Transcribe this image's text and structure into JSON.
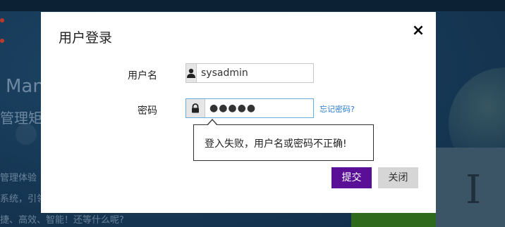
{
  "background": {
    "text_1": "Man",
    "text_2": "管理矩",
    "text_3": "管理体验",
    "text_4": "系统，引领",
    "text_5": "捷、高效、智能！还等什么呢?",
    "right_glyph": "I"
  },
  "dialog": {
    "title": "用户登录",
    "close_icon": "×",
    "username": {
      "label": "用户名",
      "value": "sysadmin",
      "icon": "user-icon"
    },
    "password": {
      "label": "密码",
      "masked_value": "●●●●●",
      "icon": "lock-icon",
      "focused": true
    },
    "forgot_link": "忘记密码?",
    "error_tooltip": "登入失败，用户名或密码不正确!",
    "submit_label": "提交",
    "close_label": "关闭"
  },
  "colors": {
    "submit_button": "#5a1096",
    "close_button": "#d6d6d6",
    "link": "#2a7bd1",
    "focus_border": "#66aee0"
  }
}
